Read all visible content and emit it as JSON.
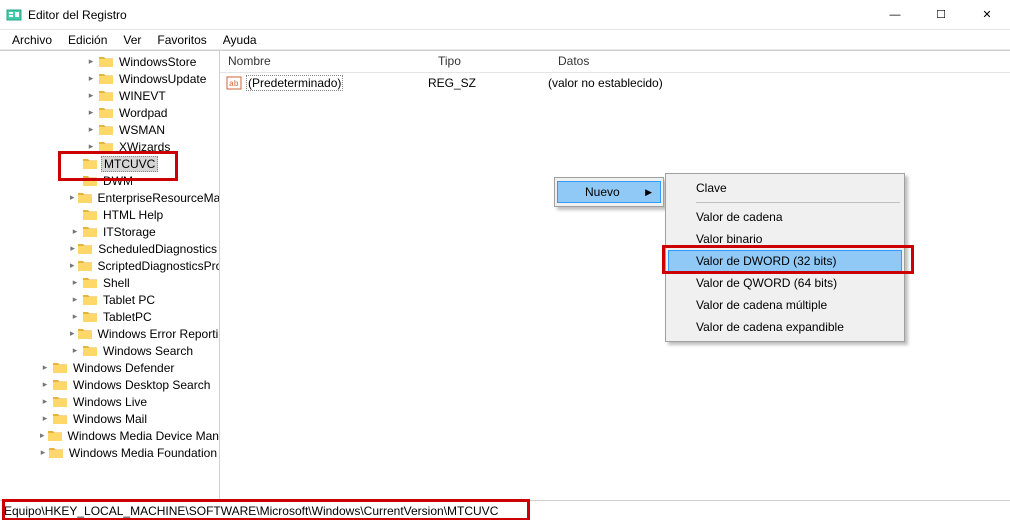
{
  "title": "Editor del Registro",
  "menus": {
    "archivo": "Archivo",
    "edicion": "Edición",
    "ver": "Ver",
    "favoritos": "Favoritos",
    "ayuda": "Ayuda"
  },
  "columns": {
    "name": "Nombre",
    "type": "Tipo",
    "data": "Datos"
  },
  "tree": [
    {
      "label": "WindowsStore",
      "chev": "closed",
      "indent": 86
    },
    {
      "label": "WindowsUpdate",
      "chev": "closed",
      "indent": 86
    },
    {
      "label": "WINEVT",
      "chev": "closed",
      "indent": 86
    },
    {
      "label": "Wordpad",
      "chev": "closed",
      "indent": 86
    },
    {
      "label": "WSMAN",
      "chev": "closed",
      "indent": 86
    },
    {
      "label": "XWizards",
      "chev": "closed",
      "indent": 86
    },
    {
      "label": "MTCUVC",
      "chev": "none",
      "indent": 70,
      "selected": true
    },
    {
      "label": "DWM",
      "chev": "none",
      "indent": 70
    },
    {
      "label": "EnterpriseResourceManager",
      "chev": "closed",
      "indent": 70
    },
    {
      "label": "HTML Help",
      "chev": "none",
      "indent": 70
    },
    {
      "label": "ITStorage",
      "chev": "closed",
      "indent": 70
    },
    {
      "label": "ScheduledDiagnostics",
      "chev": "closed",
      "indent": 70
    },
    {
      "label": "ScriptedDiagnosticsProvider",
      "chev": "closed",
      "indent": 70
    },
    {
      "label": "Shell",
      "chev": "closed",
      "indent": 70
    },
    {
      "label": "Tablet PC",
      "chev": "closed",
      "indent": 70
    },
    {
      "label": "TabletPC",
      "chev": "closed",
      "indent": 70
    },
    {
      "label": "Windows Error Reporting",
      "chev": "closed",
      "indent": 70
    },
    {
      "label": "Windows Search",
      "chev": "closed",
      "indent": 70
    },
    {
      "label": "Windows Defender",
      "chev": "closed",
      "indent": 40
    },
    {
      "label": "Windows Desktop Search",
      "chev": "closed",
      "indent": 40
    },
    {
      "label": "Windows Live",
      "chev": "closed",
      "indent": 40
    },
    {
      "label": "Windows Mail",
      "chev": "closed",
      "indent": 40
    },
    {
      "label": "Windows Media Device Manager",
      "chev": "closed",
      "indent": 40
    },
    {
      "label": "Windows Media Foundation",
      "chev": "closed",
      "indent": 40
    }
  ],
  "values": [
    {
      "name": "(Predeterminado)",
      "type": "REG_SZ",
      "data": "(valor no establecido)",
      "selected": true
    }
  ],
  "context": {
    "parent": {
      "nuevo": "Nuevo"
    },
    "submenu": {
      "clave": "Clave",
      "cadena": "Valor de cadena",
      "binario": "Valor binario",
      "dword": "Valor de DWORD (32 bits)",
      "qword": "Valor de QWORD (64 bits)",
      "multiple": "Valor de cadena múltiple",
      "expandible": "Valor de cadena expandible"
    }
  },
  "status_path": "Equipo\\HKEY_LOCAL_MACHINE\\SOFTWARE\\Microsoft\\Windows\\CurrentVersion\\MTCUVC"
}
